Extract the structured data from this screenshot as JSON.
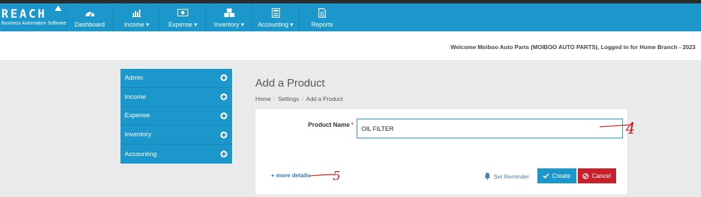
{
  "app": {
    "logo_text": "REACH",
    "logo_subtitle": "Business Automation Software"
  },
  "nav": [
    {
      "label": "Dashboard",
      "icon": "dashboard-gauge-icon"
    },
    {
      "label": "Income",
      "icon": "bar-chart-icon"
    },
    {
      "label": "Expense",
      "icon": "money-icon"
    },
    {
      "label": "Inventory",
      "icon": "cubes-icon"
    },
    {
      "label": "Accounting",
      "icon": "calculator-icon"
    },
    {
      "label": "Reports",
      "icon": "document-icon"
    }
  ],
  "header": {
    "welcome": "Welcome Moiboo Auto Parts (MOIBOO AUTO PARTS), Logged in for Home Branch - 2023"
  },
  "sidebar": {
    "items": [
      {
        "label": "Admin"
      },
      {
        "label": "Income"
      },
      {
        "label": "Expense"
      },
      {
        "label": "Inventory"
      },
      {
        "label": "Accounting"
      }
    ]
  },
  "page": {
    "title": "Add a Product",
    "breadcrumb": [
      "Home",
      "Settings",
      "Add a Product"
    ]
  },
  "form": {
    "product_name_label": "Product Name",
    "required_mark": "*",
    "product_name_value": "OIL FILTER",
    "more_details": "+ more details",
    "set_reminder": "Set Reminder",
    "create": "Create",
    "cancel": "Cancel"
  },
  "annotations": {
    "mark_4": "4",
    "mark_5": "5"
  },
  "colors": {
    "primary": "#1b97cb",
    "danger": "#c8202a",
    "annotation": "#d11a1a"
  }
}
